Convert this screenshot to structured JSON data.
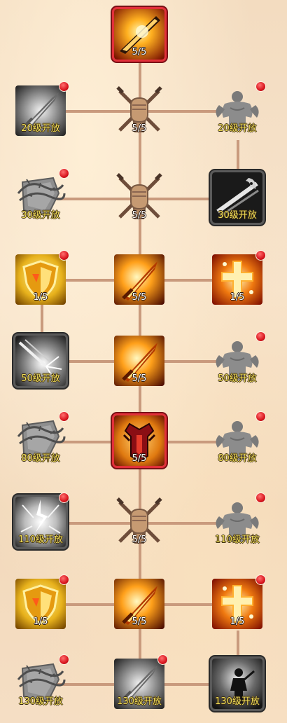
{
  "colors": {
    "background": "#f3dcc0",
    "connector": "#c99a7d",
    "frame_red": "#e2303a",
    "notify_dot": "#d9161e",
    "level_text": "#ffffff",
    "lock_text": "#f3e15a"
  },
  "skill_tree": {
    "rows": [
      {
        "row": 1,
        "nodes": [
          {
            "column": "center",
            "icon": "fire-blade-skill-icon",
            "frame": "red",
            "label": "5/5",
            "locked": false,
            "notification": false
          }
        ]
      },
      {
        "row": 2,
        "nodes": [
          {
            "column": "left",
            "icon": "grey-sword-skill-icon",
            "frame": "none",
            "label": "20级开放",
            "locked": true,
            "notification": true
          },
          {
            "column": "center",
            "icon": "fist-crossed-swords-icon",
            "frame": "none",
            "label": "5/5",
            "locked": false,
            "notification": false
          },
          {
            "column": "right",
            "icon": "muscle-figure-icon",
            "frame": "none",
            "label": "20级开放",
            "locked": true,
            "notification": true
          }
        ]
      },
      {
        "row": 3,
        "nodes": [
          {
            "column": "left",
            "icon": "thorn-shield-icon",
            "frame": "none",
            "label": "30级开放",
            "locked": true,
            "notification": true
          },
          {
            "column": "center",
            "icon": "fist-crossed-swords-icon",
            "frame": "none",
            "label": "5/5",
            "locked": false,
            "notification": false
          },
          {
            "column": "right",
            "icon": "ghost-slash-skill-icon",
            "frame": "dark",
            "label": "30级开放",
            "locked": true,
            "notification": false
          }
        ]
      },
      {
        "row": 4,
        "nodes": [
          {
            "column": "left",
            "icon": "golden-shield-skill-icon",
            "frame": "none",
            "label": "1/5",
            "locked": false,
            "notification": true
          },
          {
            "column": "center",
            "icon": "flaming-sword-skill-icon",
            "frame": "none",
            "label": "5/5",
            "locked": false,
            "notification": false
          },
          {
            "column": "right",
            "icon": "holy-cross-skill-icon",
            "frame": "none",
            "label": "1/5",
            "locked": false,
            "notification": true
          }
        ]
      },
      {
        "row": 5,
        "nodes": [
          {
            "column": "left",
            "icon": "lance-burst-skill-icon",
            "frame": "dark",
            "label": "50级开放",
            "locked": true,
            "notification": false
          },
          {
            "column": "center",
            "icon": "flaming-sword-skill-icon",
            "frame": "none",
            "label": "5/5",
            "locked": false,
            "notification": false
          },
          {
            "column": "right",
            "icon": "muscle-figure-icon",
            "frame": "none",
            "label": "50级开放",
            "locked": true,
            "notification": true
          }
        ]
      },
      {
        "row": 6,
        "nodes": [
          {
            "column": "left",
            "icon": "thorn-shield-icon",
            "frame": "none",
            "label": "80级开放",
            "locked": true,
            "notification": true
          },
          {
            "column": "center",
            "icon": "crimson-armor-skill-icon",
            "frame": "red",
            "label": "5/5",
            "locked": false,
            "notification": false
          },
          {
            "column": "right",
            "icon": "muscle-figure-icon",
            "frame": "none",
            "label": "80级开放",
            "locked": true,
            "notification": true
          }
        ]
      },
      {
        "row": 7,
        "nodes": [
          {
            "column": "left",
            "icon": "lightning-burst-skill-icon",
            "frame": "dark",
            "label": "110级开放",
            "locked": true,
            "notification": true
          },
          {
            "column": "center",
            "icon": "fist-crossed-swords-icon",
            "frame": "none",
            "label": "5/5",
            "locked": false,
            "notification": false
          },
          {
            "column": "right",
            "icon": "muscle-figure-icon",
            "frame": "none",
            "label": "110级开放",
            "locked": true,
            "notification": true
          }
        ]
      },
      {
        "row": 8,
        "nodes": [
          {
            "column": "left",
            "icon": "golden-shield-skill-icon",
            "frame": "none",
            "label": "1/5",
            "locked": false,
            "notification": true
          },
          {
            "column": "center",
            "icon": "flaming-sword-skill-icon",
            "frame": "none",
            "label": "5/5",
            "locked": false,
            "notification": false
          },
          {
            "column": "right",
            "icon": "holy-cross-skill-icon",
            "frame": "none",
            "label": "1/5",
            "locked": false,
            "notification": true
          }
        ]
      },
      {
        "row": 9,
        "nodes": [
          {
            "column": "left",
            "icon": "thorn-shield-icon",
            "frame": "none",
            "label": "130级开放",
            "locked": true,
            "notification": true
          },
          {
            "column": "center",
            "icon": "grey-sword-skill-icon",
            "frame": "none",
            "label": "130级开放",
            "locked": true,
            "notification": true
          },
          {
            "column": "right",
            "icon": "shadow-warrior-skill-icon",
            "frame": "dark",
            "label": "130级开放",
            "locked": true,
            "notification": false
          }
        ]
      }
    ]
  }
}
